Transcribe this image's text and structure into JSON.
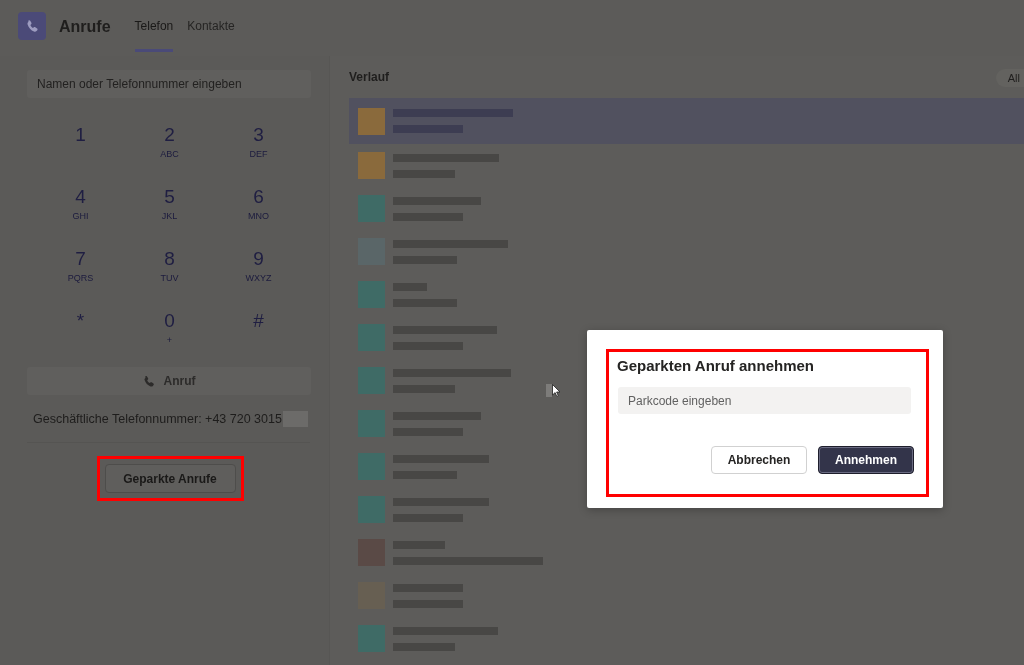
{
  "app": {
    "title": "Anrufe"
  },
  "tabs": [
    {
      "label": "Telefon",
      "selected": true
    },
    {
      "label": "Kontakte",
      "selected": false
    }
  ],
  "search": {
    "placeholder": "Namen oder Telefonnummer eingeben"
  },
  "keypad": [
    {
      "digit": "1"
    },
    {
      "digit": "2",
      "letters": "ABC"
    },
    {
      "digit": "3",
      "letters": "DEF"
    },
    {
      "digit": "4",
      "letters": "GHI"
    },
    {
      "digit": "5",
      "letters": "JKL"
    },
    {
      "digit": "6",
      "letters": "MNO"
    },
    {
      "digit": "7",
      "letters": "PQRS"
    },
    {
      "digit": "8",
      "letters": "TUV"
    },
    {
      "digit": "9",
      "letters": "WXYZ"
    },
    {
      "digit": "*"
    },
    {
      "digit": "0",
      "letters": "+"
    },
    {
      "digit": "#"
    }
  ],
  "call_button": {
    "label": "Anruf",
    "disabled": true
  },
  "business_number": {
    "label": "Geschäftliche Telefonnummer: +43 720 3015",
    "redacted": true
  },
  "parked_calls_button": {
    "label": "Geparkte Anrufe",
    "highlighted": true
  },
  "history": {
    "title": "Verlauf",
    "filter": "All",
    "rows": [
      {
        "color": "#8a6a3c",
        "selected": true
      },
      {
        "color": "#8a6a3c",
        "selected": false
      },
      {
        "color": "#3f6b66",
        "selected": false
      },
      {
        "color": "#5a6668",
        "selected": false
      },
      {
        "color": "#3f6b66",
        "selected": false
      },
      {
        "color": "#3f6b66",
        "selected": false
      },
      {
        "color": "#3f6b66",
        "selected": false
      },
      {
        "color": "#3f6b66",
        "selected": false
      },
      {
        "color": "#3f6b66",
        "selected": false
      },
      {
        "color": "#3f6b66",
        "selected": false
      },
      {
        "color": "#5a4a46",
        "selected": false
      },
      {
        "color": "#675f52",
        "selected": false
      },
      {
        "color": "#3f6b66",
        "selected": false
      }
    ]
  },
  "dialog": {
    "title": "Geparkten Anruf annehmen",
    "field": {
      "placeholder": "Parkcode eingeben"
    },
    "highlighted": true,
    "buttons": [
      {
        "label": "Abbrechen",
        "kind": "secondary"
      },
      {
        "label": "Annehmen",
        "kind": "primary"
      }
    ]
  }
}
